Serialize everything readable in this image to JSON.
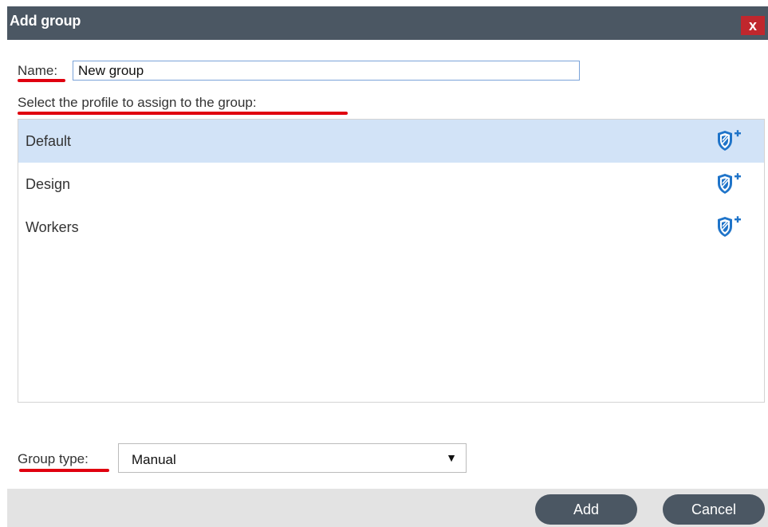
{
  "dialog": {
    "title": "Add group",
    "close_label": "x"
  },
  "name_field": {
    "label": "Name:",
    "value": "New group"
  },
  "profile_section": {
    "label": "Select the profile to assign to the group:",
    "items": [
      {
        "label": "Default",
        "selected": true,
        "icon": "shield-plus-icon"
      },
      {
        "label": "Design",
        "selected": false,
        "icon": "shield-plus-icon"
      },
      {
        "label": "Workers",
        "selected": false,
        "icon": "shield-plus-icon"
      }
    ]
  },
  "group_type": {
    "label": "Group type:",
    "value": "Manual",
    "caret": "▼"
  },
  "footer": {
    "add_label": "Add",
    "cancel_label": "Cancel"
  },
  "colors": {
    "titlebar": "#4b5763",
    "close": "#c0272d",
    "selected_row": "#d2e3f7",
    "icon_blue": "#1f74c9",
    "annotation_red": "#e0000f"
  }
}
